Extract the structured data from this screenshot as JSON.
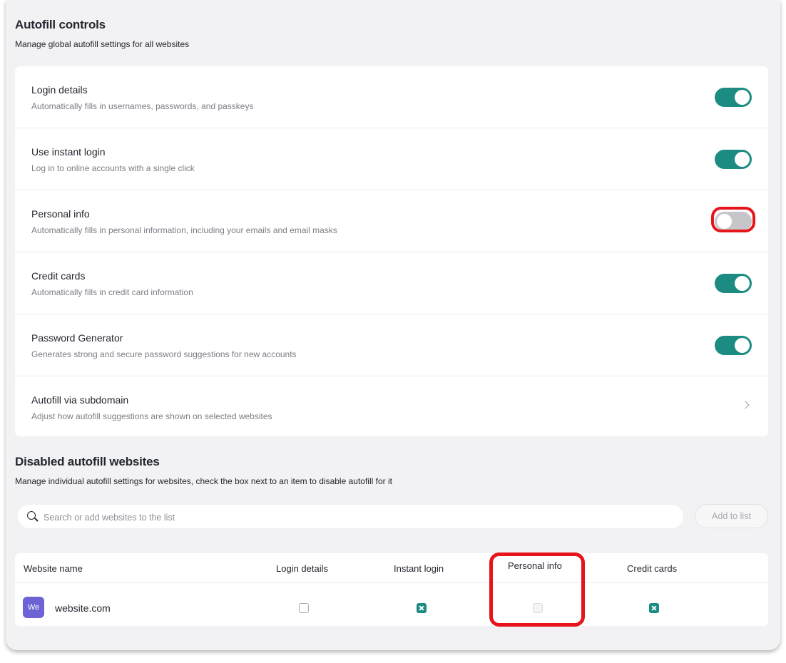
{
  "autofill_controls": {
    "title": "Autofill controls",
    "subtitle": "Manage global autofill settings for all websites",
    "settings": [
      {
        "title": "Login details",
        "description": "Automatically fills in usernames, passwords, and passkeys",
        "enabled": true
      },
      {
        "title": "Use instant login",
        "description": "Log in to online accounts with a single click",
        "enabled": true
      },
      {
        "title": "Personal info",
        "description": "Automatically fills in personal information, including your emails and email masks",
        "enabled": false
      },
      {
        "title": "Credit cards",
        "description": "Automatically fills in credit card information",
        "enabled": true
      },
      {
        "title": "Password Generator",
        "description": "Generates strong and secure password suggestions for new accounts",
        "enabled": true
      },
      {
        "title": "Autofill via subdomain",
        "description": "Adjust how autofill suggestions are shown on selected websites"
      }
    ]
  },
  "disabled_websites": {
    "title": "Disabled autofill websites",
    "subtitle": "Manage individual autofill settings for websites, check the box next to an item to disable autofill for it",
    "search_placeholder": "Search or add websites to the list",
    "add_button": "Add to list",
    "columns": [
      "Website name",
      "Login details",
      "Instant login",
      "Personal info",
      "Credit cards"
    ],
    "rows": [
      {
        "avatar": "We",
        "name": "website.com",
        "login_details": "unchecked",
        "instant_login": "checked",
        "personal_info": "disabled",
        "credit_cards": "checked"
      }
    ]
  },
  "colors": {
    "accent": "#1c8c83",
    "highlight": "#e8141c",
    "avatar": "#6d63d4"
  }
}
